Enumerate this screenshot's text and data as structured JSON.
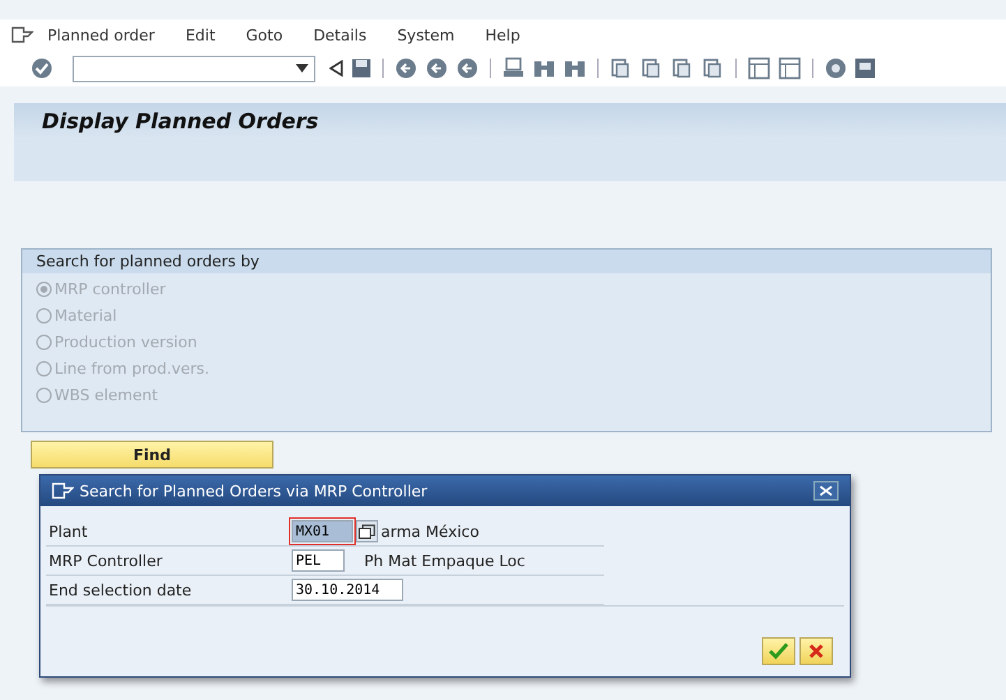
{
  "menu_bar": [
    {
      "label": "Planned order"
    },
    {
      "label": "Edit"
    },
    {
      "label": "Goto"
    },
    {
      "label": "Details"
    },
    {
      "label": "System"
    },
    {
      "label": "Help"
    }
  ],
  "screen_title": "Display Planned Orders",
  "search_group": {
    "title": "Search for planned orders by",
    "options": [
      {
        "label": "MRP controller",
        "selected": true,
        "disabled": true
      },
      {
        "label": "Material",
        "selected": false,
        "disabled": true
      },
      {
        "label": "Production version",
        "selected": false,
        "disabled": true
      },
      {
        "label": "Line from prod.vers.",
        "selected": false,
        "disabled": true
      },
      {
        "label": "WBS element",
        "selected": false,
        "disabled": true
      }
    ]
  },
  "find_button": "Find",
  "dialog": {
    "title": "Search for Planned Orders via MRP Controller",
    "fields": [
      {
        "label": "Plant",
        "value": "MX01",
        "description": "arma México",
        "focused": true,
        "value_help": true
      },
      {
        "label": "MRP Controller",
        "value": "PEL",
        "description": "Ph Mat Empaque Loc",
        "focused": false,
        "value_help": false
      },
      {
        "label": "End selection date",
        "value": "30.10.2014",
        "focused": false,
        "value_help": false
      }
    ]
  }
}
